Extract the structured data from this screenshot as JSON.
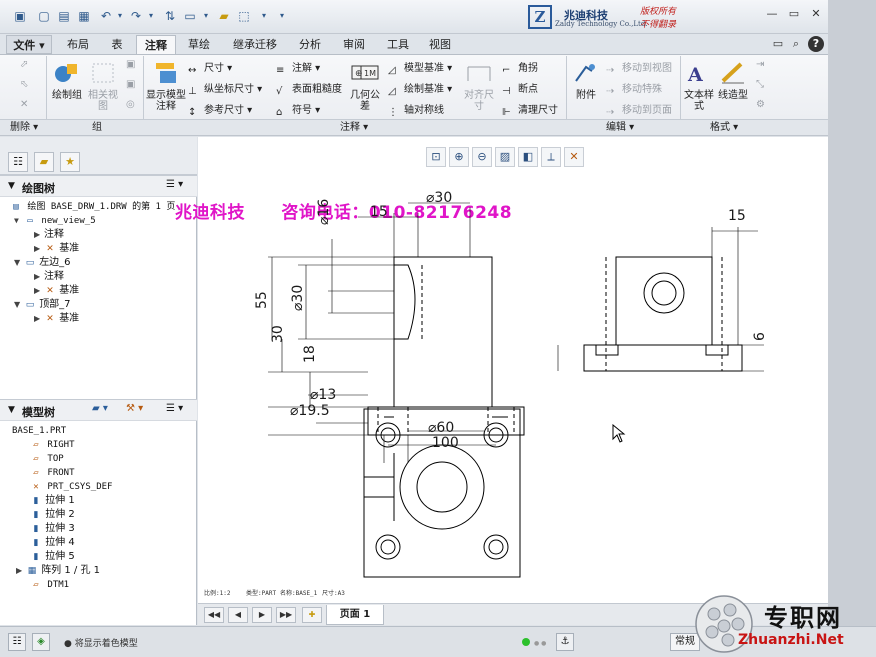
{
  "brand": {
    "name_cn": "兆迪科技",
    "name_en": "Zaldy Technology Co.,Ltd.",
    "copyright_line1": "版权所有",
    "copyright_line2": "不得翻录"
  },
  "tabs": [
    {
      "label": "文件"
    },
    {
      "label": "布局"
    },
    {
      "label": "表"
    },
    {
      "label": "注释"
    },
    {
      "label": "草绘"
    },
    {
      "label": "继承迁移"
    },
    {
      "label": "分析"
    },
    {
      "label": "审阅"
    },
    {
      "label": "工具"
    },
    {
      "label": "视图"
    }
  ],
  "ribbon": {
    "draw_group_label": "绘制组",
    "related_view": "相关视图",
    "show_model_annotations": "显示模型注释",
    "dimension": "尺寸",
    "ordinate_dimension": "纵坐标尺寸",
    "reference_dimension": "参考尺寸",
    "note": "注解",
    "surface_finish": "表面粗糙度",
    "symbol": "符号",
    "geometric_tolerance": "几何公差",
    "model_datum": "模型基准",
    "draw_datum": "绘制基准",
    "axis_symmetry": "轴对称线",
    "chamfer": "角拐",
    "break_point": "断点",
    "cleanup_dimension": "清理尺寸",
    "align_dimension": "对齐尺寸",
    "attach": "附件",
    "move_to_view": "移动到视图",
    "move_special": "移动特殊",
    "move_to_page": "移动到页面",
    "text_style": "文本样式",
    "line_style": "线造型"
  },
  "groups": {
    "delete": "删除",
    "group": "组",
    "annotation": "注释",
    "edit": "编辑",
    "format": "格式"
  },
  "drawing_tree": {
    "title": "绘图树",
    "items": [
      {
        "label": "绘图 BASE_DRW_1.DRW 的第 1 页"
      },
      {
        "label": "new_view_5"
      },
      {
        "label": "注释"
      },
      {
        "label": "基准"
      },
      {
        "label": "左边_6"
      },
      {
        "label": "注释"
      },
      {
        "label": "基准"
      },
      {
        "label": "顶部_7"
      },
      {
        "label": "基准"
      }
    ]
  },
  "model_tree": {
    "title": "模型树",
    "items": [
      {
        "label": "BASE_1.PRT"
      },
      {
        "label": "RIGHT"
      },
      {
        "label": "TOP"
      },
      {
        "label": "FRONT"
      },
      {
        "label": "PRT_CSYS_DEF"
      },
      {
        "label": "拉伸 1"
      },
      {
        "label": "拉伸 2"
      },
      {
        "label": "拉伸 3"
      },
      {
        "label": "拉伸 4"
      },
      {
        "label": "拉伸 5"
      },
      {
        "label": "阵列 1 / 孔 1"
      },
      {
        "label": "DTM1"
      }
    ]
  },
  "watermark": {
    "company": "兆迪科技",
    "phone": "咨询电话：010-82176248"
  },
  "dimensions": {
    "d1": "⌀30",
    "d2": "15",
    "d3": "⌀16",
    "d4": "55",
    "d5": "⌀30",
    "d6": "30",
    "d7": "18",
    "d8": "⌀13",
    "d9": "⌀19.5",
    "d10": "⌀60",
    "d11": "100",
    "d12": "15",
    "d13": "6"
  },
  "scale_notes": {
    "scale": "比例:1:2",
    "type": "类型:PART",
    "name": "名称:BASE_1",
    "size": "尺寸:A3"
  },
  "pagebar": {
    "page_label": "页面 1"
  },
  "status": {
    "message": "将显示着色模型",
    "mode": "常规"
  },
  "site_watermark": {
    "cn": "专职网",
    "en": "Zhuanzhi.Net"
  },
  "colors": {
    "accent": "#2b5e9a",
    "watermark": "#e015c8",
    "copyright": "#c0201c"
  }
}
